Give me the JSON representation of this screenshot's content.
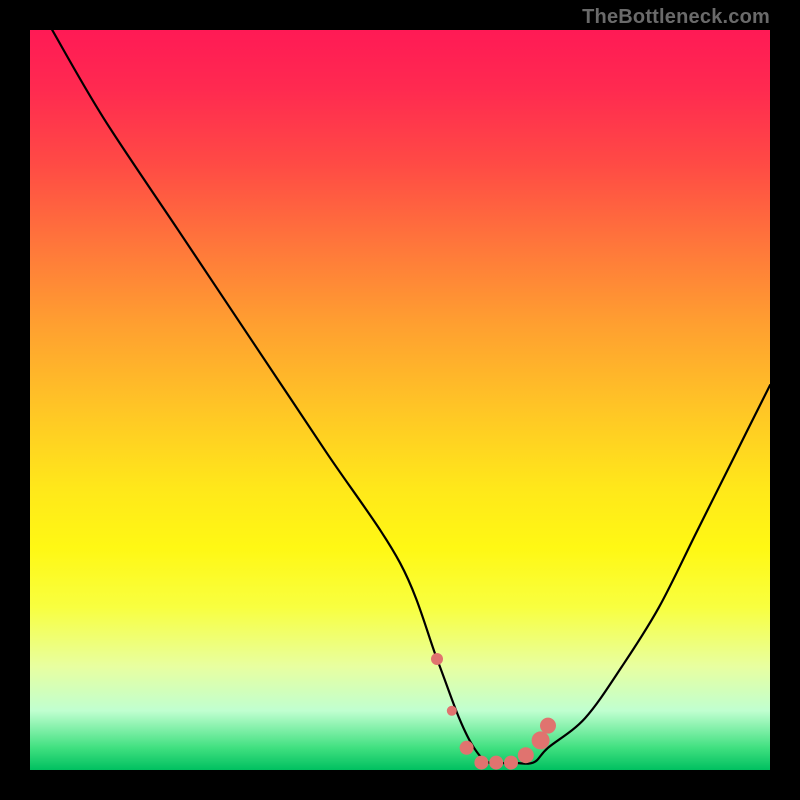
{
  "watermark": "TheBottleneck.com",
  "chart_data": {
    "type": "line",
    "title": "",
    "xlabel": "",
    "ylabel": "",
    "ylim": [
      0,
      100
    ],
    "xlim": [
      0,
      100
    ],
    "series": [
      {
        "name": "bottleneck-curve",
        "x": [
          3,
          10,
          20,
          30,
          40,
          50,
          55,
          58,
          60,
          62,
          65,
          68,
          70,
          75,
          80,
          85,
          90,
          95,
          100
        ],
        "y": [
          100,
          88,
          73,
          58,
          43,
          28,
          15,
          7,
          3,
          1,
          1,
          1,
          3,
          7,
          14,
          22,
          32,
          42,
          52
        ]
      }
    ],
    "markers": {
      "name": "highlight-points",
      "color": "#e0736f",
      "points": [
        {
          "x": 55,
          "y": 15,
          "r": 6
        },
        {
          "x": 57,
          "y": 8,
          "r": 5
        },
        {
          "x": 59,
          "y": 3,
          "r": 7
        },
        {
          "x": 61,
          "y": 1,
          "r": 7
        },
        {
          "x": 63,
          "y": 1,
          "r": 7
        },
        {
          "x": 65,
          "y": 1,
          "r": 7
        },
        {
          "x": 67,
          "y": 2,
          "r": 8
        },
        {
          "x": 69,
          "y": 4,
          "r": 9
        },
        {
          "x": 70,
          "y": 6,
          "r": 8
        }
      ]
    },
    "gradient_stops": [
      {
        "pos": 0,
        "color": "#ff1a55"
      },
      {
        "pos": 50,
        "color": "#ffe81a"
      },
      {
        "pos": 100,
        "color": "#00c060"
      }
    ]
  }
}
